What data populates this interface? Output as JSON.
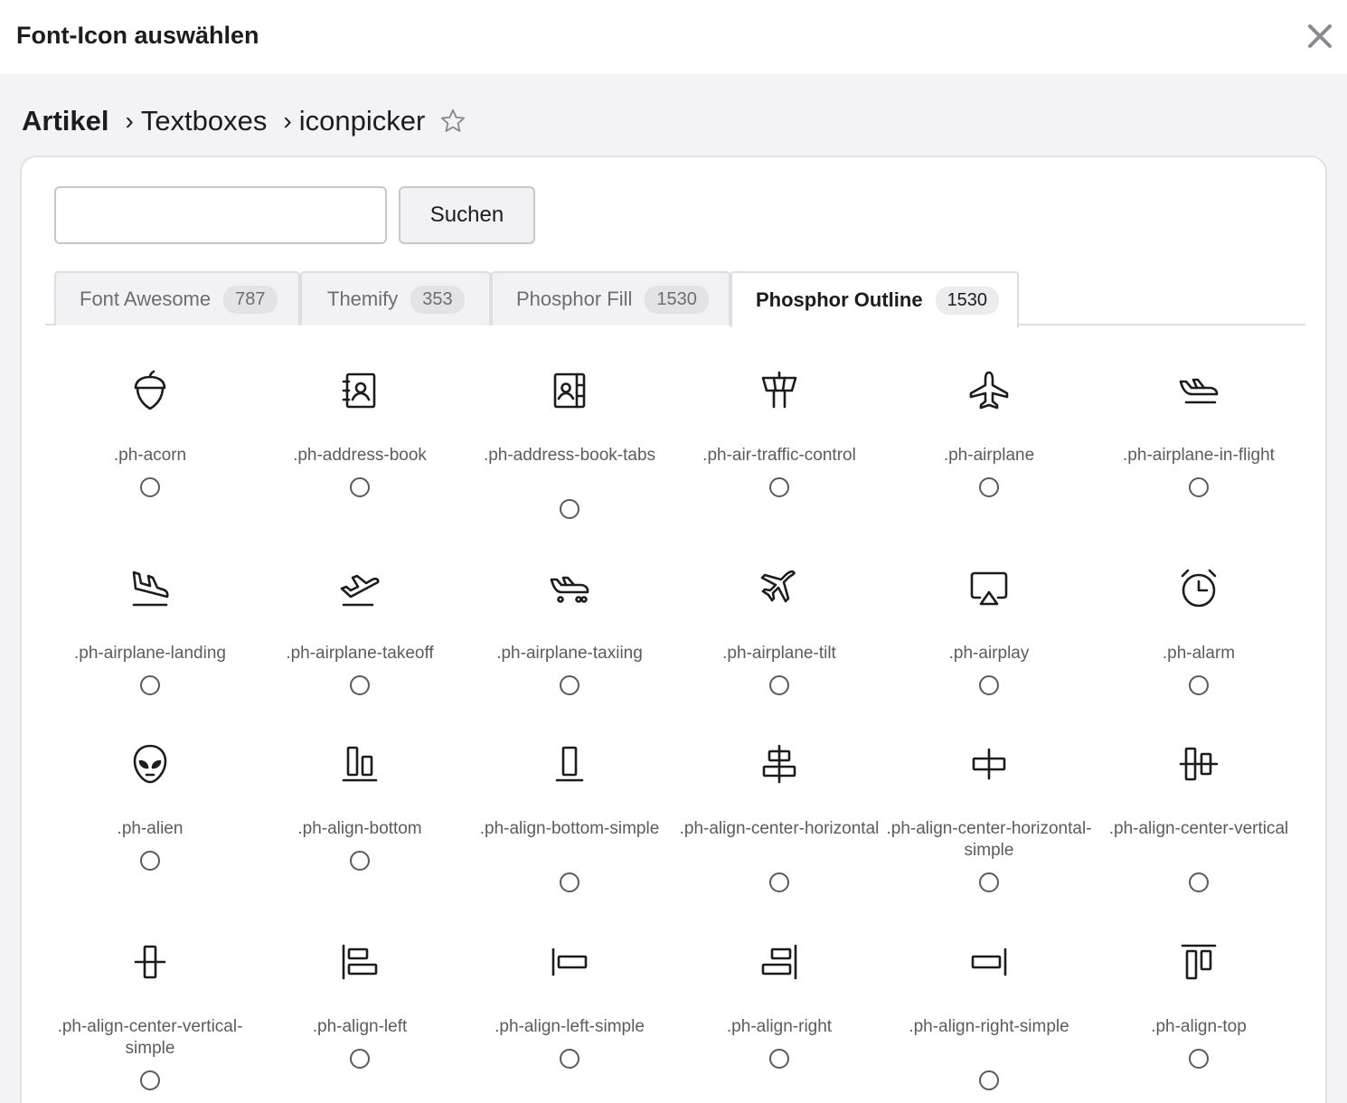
{
  "dialog": {
    "title": "Font-Icon auswählen"
  },
  "breadcrumb": {
    "root": "Artikel",
    "separator": "›",
    "level1": "Textboxes",
    "level2": "iconpicker"
  },
  "search": {
    "value": "",
    "placeholder": "",
    "button_label": "Suchen"
  },
  "tabs": [
    {
      "label": "Font Awesome",
      "count": "787",
      "active": false
    },
    {
      "label": "Themify",
      "count": "353",
      "active": false
    },
    {
      "label": "Phosphor Fill",
      "count": "1530",
      "active": false
    },
    {
      "label": "Phosphor Outline",
      "count": "1530",
      "active": true
    }
  ],
  "icons": [
    {
      "icon": "acorn-icon",
      "label": ".ph-acorn"
    },
    {
      "icon": "address-book-icon",
      "label": ".ph-address-book"
    },
    {
      "icon": "address-book-tabs-icon",
      "label": ".ph-address-book-tabs"
    },
    {
      "icon": "air-traffic-control-icon",
      "label": ".ph-air-traffic-control"
    },
    {
      "icon": "airplane-icon",
      "label": ".ph-airplane"
    },
    {
      "icon": "airplane-in-flight-icon",
      "label": ".ph-airplane-in-flight"
    },
    {
      "icon": "airplane-landing-icon",
      "label": ".ph-airplane-landing"
    },
    {
      "icon": "airplane-takeoff-icon",
      "label": ".ph-airplane-takeoff"
    },
    {
      "icon": "airplane-taxiing-icon",
      "label": ".ph-airplane-taxiing"
    },
    {
      "icon": "airplane-tilt-icon",
      "label": ".ph-airplane-tilt"
    },
    {
      "icon": "airplay-icon",
      "label": ".ph-airplay"
    },
    {
      "icon": "alarm-icon",
      "label": ".ph-alarm"
    },
    {
      "icon": "alien-icon",
      "label": ".ph-alien"
    },
    {
      "icon": "align-bottom-icon",
      "label": ".ph-align-bottom"
    },
    {
      "icon": "align-bottom-simple-icon",
      "label": ".ph-align-bottom-simple"
    },
    {
      "icon": "align-center-horizontal-icon",
      "label": ".ph-align-center-horizontal"
    },
    {
      "icon": "align-center-horizontal-simple-icon",
      "label": ".ph-align-center-horizontal-simple"
    },
    {
      "icon": "align-center-vertical-icon",
      "label": ".ph-align-center-vertical"
    },
    {
      "icon": "align-center-vertical-simple-icon",
      "label": ".ph-align-center-vertical-simple"
    },
    {
      "icon": "align-left-icon",
      "label": ".ph-align-left"
    },
    {
      "icon": "align-left-simple-icon",
      "label": ".ph-align-left-simple"
    },
    {
      "icon": "align-right-icon",
      "label": ".ph-align-right"
    },
    {
      "icon": "align-right-simple-icon",
      "label": ".ph-align-right-simple"
    },
    {
      "icon": "align-top-icon",
      "label": ".ph-align-top"
    }
  ]
}
